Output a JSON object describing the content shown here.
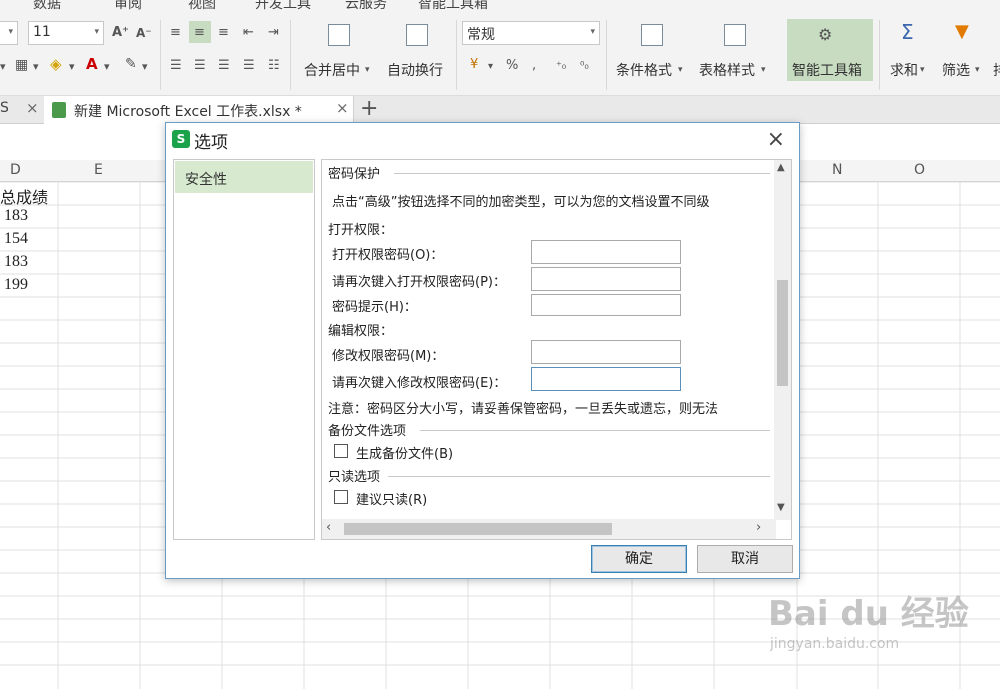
{
  "ribbon": {
    "menu_tabs": [
      "数据",
      "审阅",
      "视图",
      "开发工具",
      "云服务",
      "智能工具箱"
    ],
    "font_size_value": "11",
    "number_format_value": "常规",
    "percent_symbol": "%",
    "comma_symbol": ",",
    "merge_center_label": "合并居中",
    "wrap_text_label": "自动换行",
    "conditional_format_label": "条件格式",
    "table_style_label": "表格样式",
    "smart_toolbox_label": "智能工具箱",
    "sum_label": "求和",
    "filter_label": "筛选",
    "truncated_label": "排"
  },
  "tabs": {
    "prev_tab_fragment": "S",
    "active_tab_label": "新建 Microsoft Excel 工作表.xlsx *"
  },
  "sheet": {
    "column_headers": [
      "D",
      "E",
      "N",
      "O"
    ],
    "header_cell": "总成绩",
    "values": [
      "183",
      "154",
      "183",
      "199"
    ]
  },
  "dialog": {
    "title": "选项",
    "sidebar_items": [
      "安全性"
    ],
    "password_section": "密码保护",
    "password_desc": "点击“高级”按钮选择不同的加密类型，可以为您的文档设置不同级",
    "open_perm": "打开权限：",
    "open_pw_label": "打开权限密码(O)：",
    "open_pw_confirm_label": "请再次键入打开权限密码(P)：",
    "pw_hint_label": "密码提示(H)：",
    "edit_perm": "编辑权限：",
    "modify_pw_label": "修改权限密码(M)：",
    "modify_pw_confirm_label": "请再次键入修改权限密码(E)：",
    "note": "注意：密码区分大小写，请妥善保管密码，一旦丢失或遗忘，则无法",
    "backup_section": "备份文件选项",
    "backup_checkbox": "生成备份文件(B)",
    "readonly_section": "只读选项",
    "readonly_checkbox": "建议只读(R)",
    "ok_button": "确定",
    "cancel_button": "取消"
  },
  "watermark": {
    "main": "Bai du 经验",
    "sub": "jingyan.baidu.com"
  }
}
